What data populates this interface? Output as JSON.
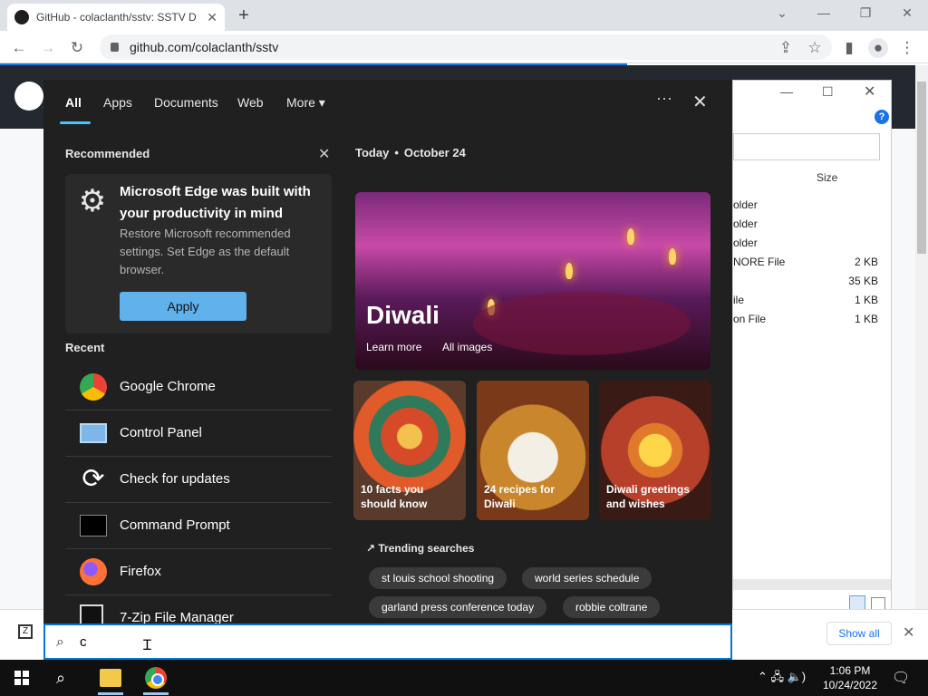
{
  "browser": {
    "tab_title": "GitHub - colaclanth/sstv: SSTV D",
    "tab_close": "✕",
    "new_tab": "+",
    "url": "github.com/colaclanth/sstv",
    "back": "←",
    "forward": "→",
    "reload": "↻",
    "win_minimize": "—",
    "win_restore": "❐",
    "win_close": "✕",
    "chevron": "⌄"
  },
  "explorer": {
    "size_header": "Size",
    "rows": [
      {
        "name": "older",
        "size": ""
      },
      {
        "name": "older",
        "size": ""
      },
      {
        "name": "older",
        "size": ""
      },
      {
        "name": "NORE File",
        "size": "2 KB"
      },
      {
        "name": "",
        "size": "35 KB"
      },
      {
        "name": "ile",
        "size": "1 KB"
      },
      {
        "name": "on File",
        "size": "1 KB"
      }
    ]
  },
  "search_panel": {
    "tabs": {
      "all": "All",
      "apps": "Apps",
      "documents": "Documents",
      "web": "Web",
      "more": "More ▾"
    },
    "more_options": "···",
    "close": "✕",
    "recommended": {
      "title": "Recommended",
      "close": "✕",
      "card_title": "Microsoft Edge was built with your productivity in mind",
      "card_desc": "Restore Microsoft recommended settings. Set Edge as the default browser.",
      "apply": "Apply"
    },
    "recent": {
      "title": "Recent",
      "items": [
        {
          "label": "Google Chrome",
          "icon": "chrome-icon"
        },
        {
          "label": "Control Panel",
          "icon": "control-panel-icon"
        },
        {
          "label": "Check for updates",
          "icon": "update-icon"
        },
        {
          "label": "Command Prompt",
          "icon": "command-prompt-icon"
        },
        {
          "label": "Firefox",
          "icon": "firefox-icon"
        },
        {
          "label": "7-Zip File Manager",
          "icon": "7zip-icon"
        }
      ]
    },
    "today": {
      "label": "Today",
      "separator": "•",
      "date": "October 24",
      "hero_title": "Diwali",
      "learn_more": "Learn more",
      "all_images": "All images",
      "tiles": [
        "10 facts you should know",
        "24 recipes for Diwali",
        "Diwali greetings and wishes"
      ]
    },
    "trending": {
      "title": "↗ Trending searches",
      "chips": [
        "st louis school shooting",
        "world series schedule",
        "garland press conference today",
        "robbie coltrane"
      ]
    }
  },
  "search_box": {
    "icon": "⌕",
    "value": "c"
  },
  "download_bar": {
    "show_all": "Show all",
    "close": "✕"
  },
  "taskbar": {
    "time": "1:06 PM",
    "date": "10/24/2022",
    "tray": "⌃  🖧  🔈)",
    "notifications": "🗨"
  }
}
